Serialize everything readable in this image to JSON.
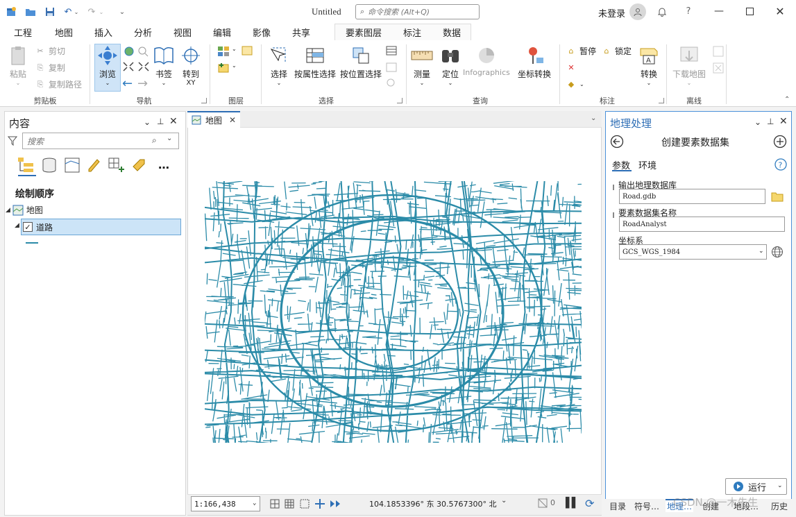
{
  "titlebar": {
    "title": "Untitled",
    "search_placeholder": "命令搜索 (Alt+Q)",
    "login": "未登录"
  },
  "ribbon_tabs": [
    "工程",
    "地图",
    "插入",
    "分析",
    "视图",
    "编辑",
    "影像",
    "共享"
  ],
  "context_tabs": [
    "要素图层",
    "标注",
    "数据"
  ],
  "active_tab": "地图",
  "ribbon": {
    "clipboard": {
      "paste": "粘贴",
      "cut": "剪切",
      "copy": "复制",
      "copy_path": "复制路径",
      "label": "剪贴板"
    },
    "navigate": {
      "explore": "浏览",
      "bookmarks": "书签",
      "goto": "转到",
      "goto_sub": "XY",
      "label": "导航"
    },
    "layer": {
      "label": "图层"
    },
    "selection": {
      "select": "选择",
      "by_attr": "按属性选择",
      "by_loc": "按位置选择",
      "label": "选择"
    },
    "inquiry": {
      "measure": "测量",
      "locate": "定位",
      "infographics": "Infographics",
      "coord_conv": "坐标转换",
      "label": "查询"
    },
    "labeling": {
      "pause": "暂停",
      "lock": "锁定",
      "convert": "转换",
      "label": "标注"
    },
    "offline": {
      "download": "下载地图",
      "label": "离线"
    }
  },
  "contents": {
    "title": "内容",
    "search_placeholder": "搜索",
    "draw_order": "绘制顺序",
    "map_name": "地图",
    "layer_name": "道路"
  },
  "map_view": {
    "tab": "地图",
    "scale": "1:166,438",
    "coords": "104.1853396° 东  30.5767300° 北",
    "selected_count": "0"
  },
  "geoprocessing": {
    "title": "地理处理",
    "tool": "创建要素数据集",
    "tabs": [
      "参数",
      "环境"
    ],
    "out_gdb_label": "输出地理数据库",
    "out_gdb_value": "Road.gdb",
    "dataset_label": "要素数据集名称",
    "dataset_value": "RoadAnalyst",
    "cs_label": "坐标系",
    "cs_value": "GCS_WGS_1984",
    "run": "运行"
  },
  "bottom_tabs": [
    "目录",
    "符号…",
    "地理…",
    "创建",
    "地段…",
    "历史"
  ],
  "watermark": "CSDN @一木先生",
  "colors": {
    "accent": "#2c6db5",
    "road": "#2b8ba8",
    "selection": "#cce4f7"
  }
}
